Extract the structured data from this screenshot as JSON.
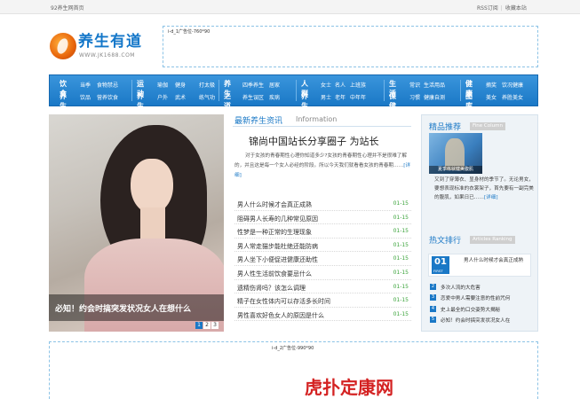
{
  "topbar": {
    "home": "92养生网首页",
    "subscribe": "RSS订阅",
    "sep": "|",
    "bookmark": "收藏本站"
  },
  "logo": {
    "name": "养生有道",
    "url": "WWW.JK1688.COM"
  },
  "ads": {
    "top_label": "i-d_1广告位-760*90",
    "bottom_label": "i-d_2广告位-990*90",
    "bottom_text": "虎扑定康网"
  },
  "nav": [
    {
      "hd1": "饮食",
      "hd2": "养生",
      "row1": [
        "当季",
        "食物禁忌"
      ],
      "row2": [
        "饮品",
        "营养饮食"
      ]
    },
    {
      "hd1": "运动",
      "hd2": "养生",
      "row1": [
        "瑜伽",
        "健身",
        "打太极"
      ],
      "row2": [
        "户外",
        "武术",
        "练气功"
      ]
    },
    {
      "hd1": "养生",
      "hd2": "之道",
      "row1": [
        "四季养生",
        "居家"
      ],
      "row2": [
        "养生误区",
        "疾病"
      ]
    },
    {
      "hd1": "人群",
      "hd2": "养生",
      "row1": [
        "女士",
        "名人",
        "上班族"
      ],
      "row2": [
        "男士",
        "老年",
        "中年年"
      ]
    },
    {
      "hd1": "生活",
      "hd2": "保健",
      "row1": [
        "常识",
        "生活用品"
      ],
      "row2": [
        "习惯",
        "健康自测"
      ]
    },
    {
      "hd1": "健康",
      "hd2": "图库",
      "row1": [
        "摘奖",
        "饮况健康"
      ],
      "row2": [
        "美女",
        "养胜美女"
      ]
    }
  ],
  "hero": {
    "caption": "必知！约会时搞突发状况女人在想什么",
    "pages": [
      "1",
      "2",
      "3"
    ],
    "active_page": "1"
  },
  "news": {
    "title": "最新养生资讯",
    "title_en": "Information",
    "headline": "锦尚中国站长分享圈子 为站长",
    "summary": "对于女孩的青春期性心理你知道多少?女孩的青春期性心理并不是很难了解的，并且这是每一个女人必经的阶段。所以今天我们就看看女孩的青春期……",
    "more": "[详细]",
    "items": [
      {
        "title": "男人什么时候才会真正成熟",
        "date": "01-15"
      },
      {
        "title": "阻碍男人长寿的几种常见原因",
        "date": "01-15"
      },
      {
        "title": "性梦是一种正常的生理现象",
        "date": "01-15"
      },
      {
        "title": "男人常走猫步能杜绝还能防病",
        "date": "01-15"
      },
      {
        "title": "男人坐下小便促进健康还助性",
        "date": "01-15"
      },
      {
        "title": "男人性生活前饮食要忌什么",
        "date": "01-15"
      },
      {
        "title": "遗精伤肾吗？该怎么调理",
        "date": "01-15"
      },
      {
        "title": "精子在女性体内可以存活多长时间",
        "date": "01-15"
      },
      {
        "title": "男性喜欢好色女人的原因是什么",
        "date": "01-15"
      }
    ]
  },
  "sidebar": {
    "pick_title": "精品推荐",
    "pick_tag": "Fine Column",
    "pick_caption": "夏季练就健美腹肌",
    "pick_text": "又到了穿薄衣、显身材的季节了。无论男女，要想表现标准的衣裳架子，首先要有一副完美的腹肌，如果日已……",
    "pick_more": "[详细]",
    "hot_title": "热文排行",
    "hot_tag": "Articles Ranking",
    "hot_first": {
      "num": "01",
      "label": "FIRST",
      "text": "男人什么时候才会真正成熟"
    },
    "hot_list": [
      {
        "n": "2",
        "t": "多次人流的大危害"
      },
      {
        "n": "3",
        "t": "恋爱中男人需要注意的性前咒何"
      },
      {
        "n": "4",
        "t": "史上最全的口交姿势大揭秘"
      },
      {
        "n": "5",
        "t": "必知！约会时搞突发状况女人在"
      }
    ]
  }
}
